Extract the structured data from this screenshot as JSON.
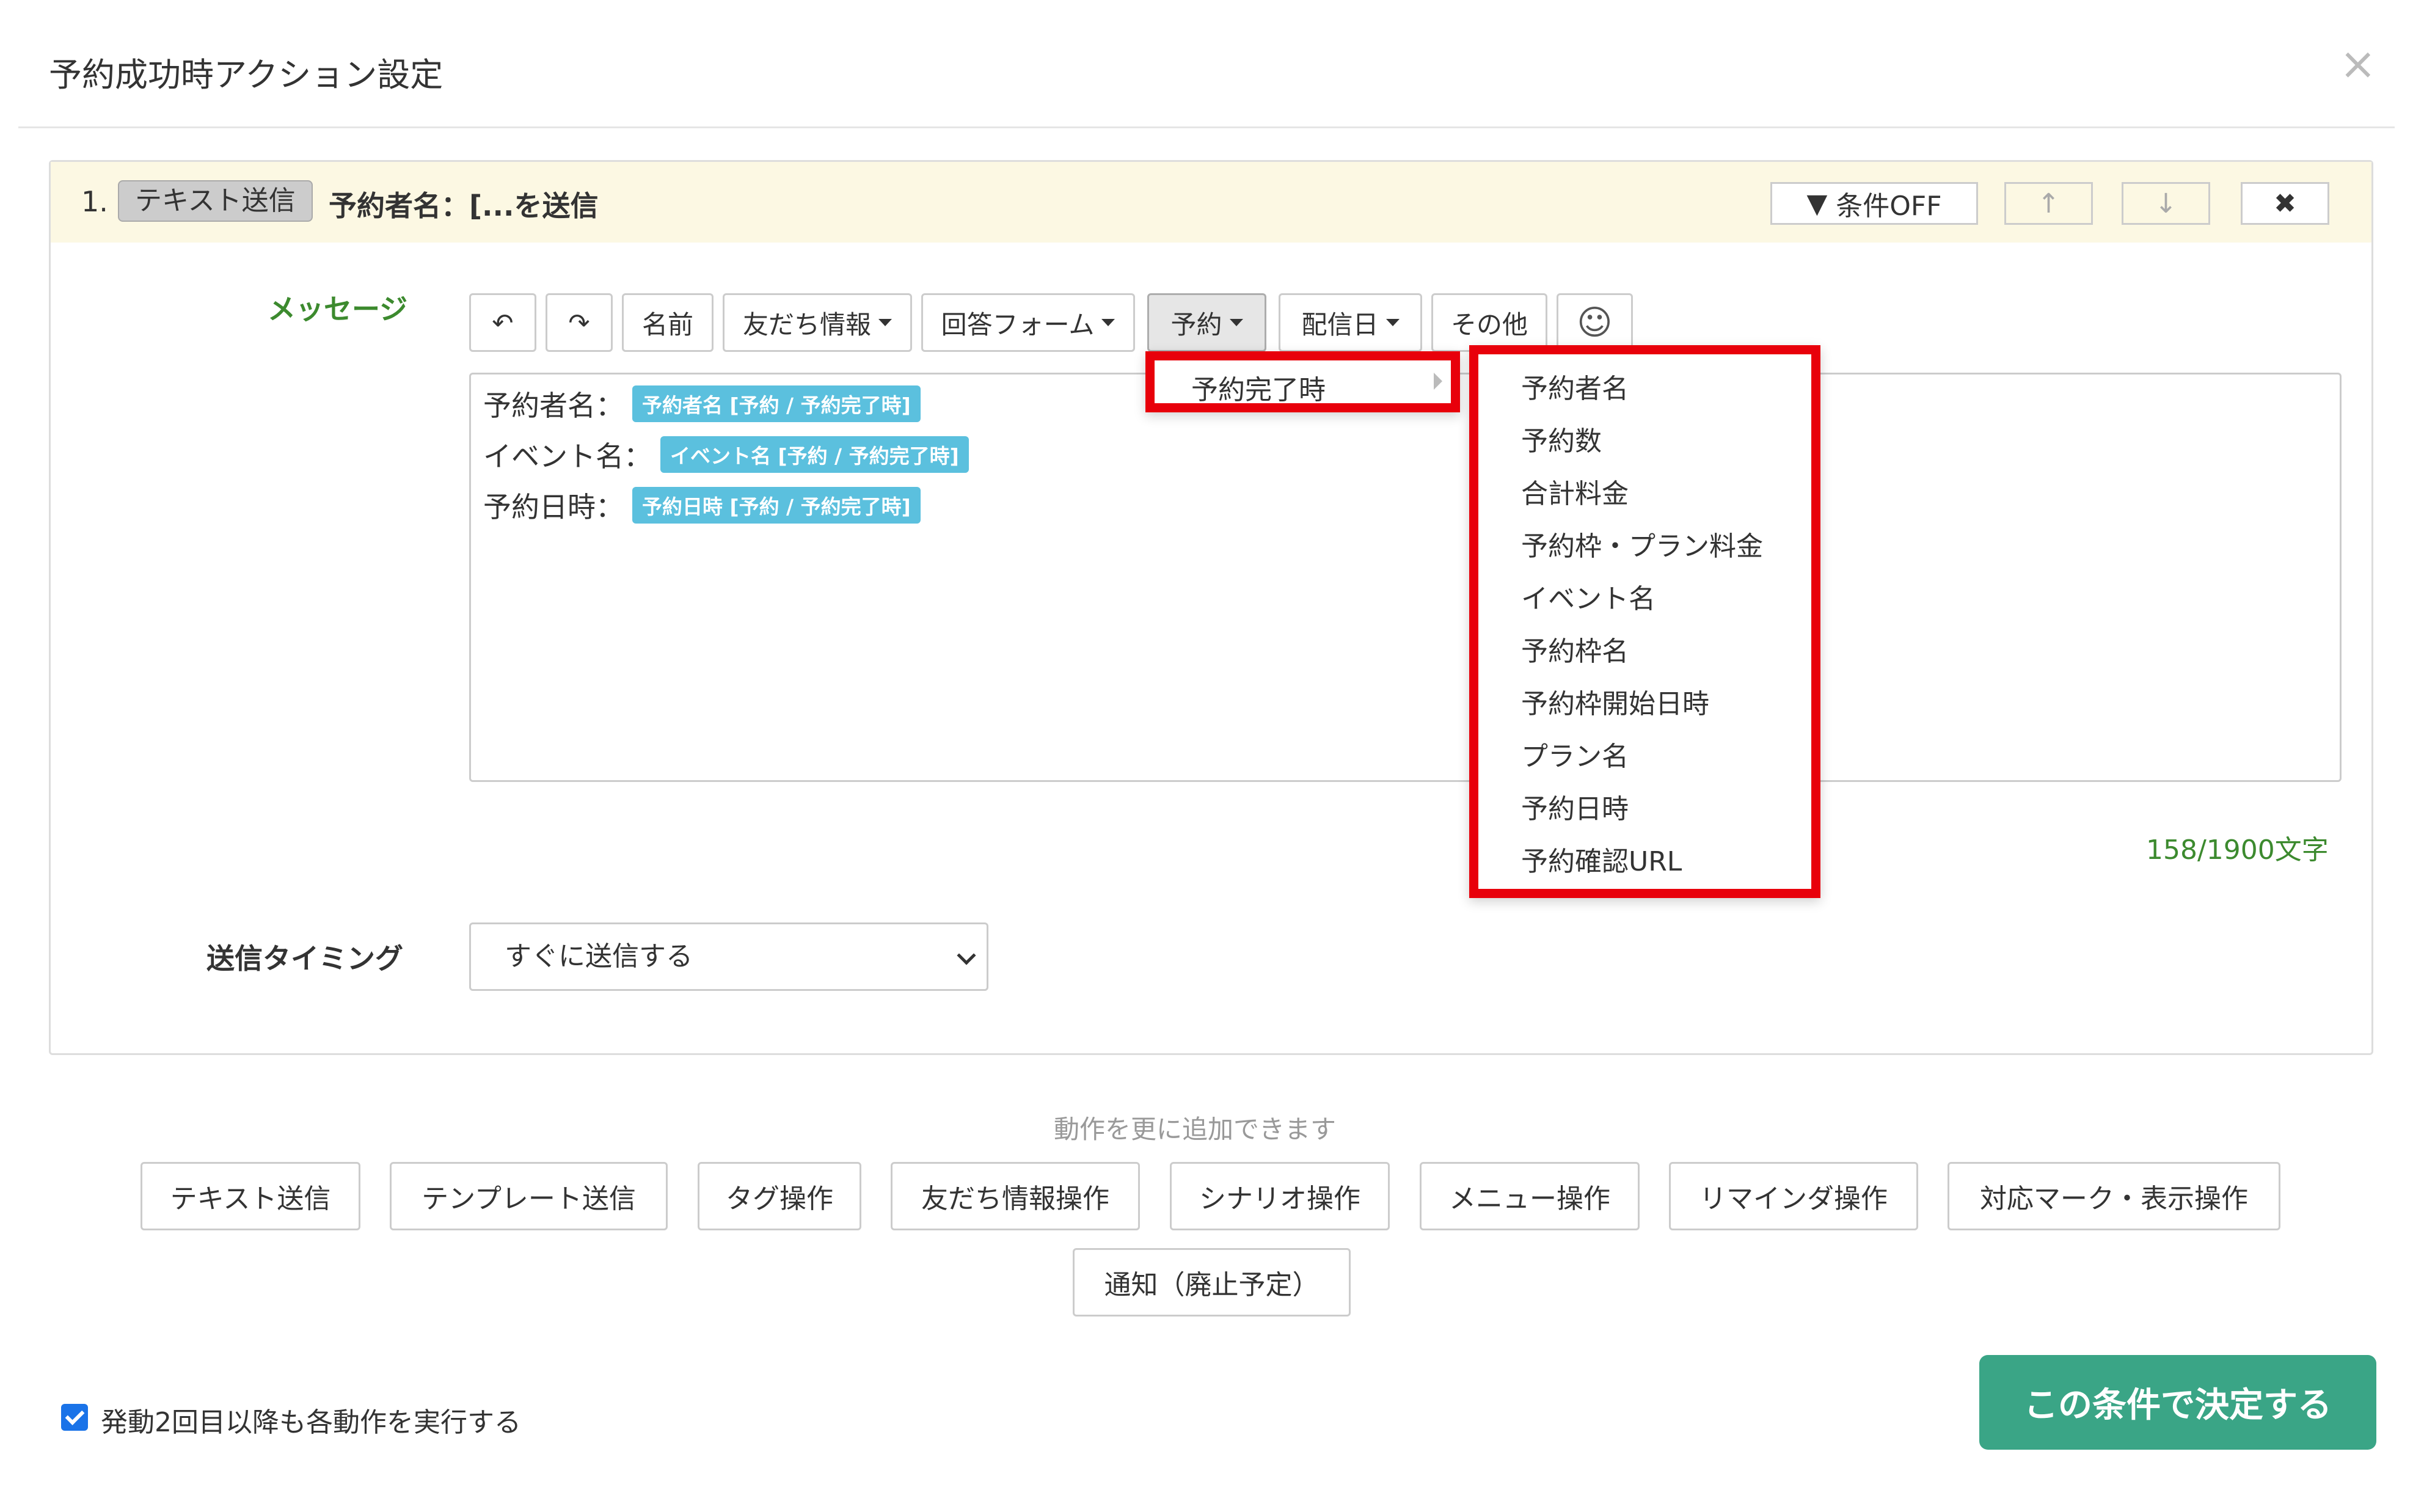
{
  "modal": {
    "title": "予約成功時アクション設定",
    "close_glyph": "×"
  },
  "action": {
    "number": "1.",
    "type_tag": "テキスト送信",
    "summary": "予約者名：[...を送信",
    "condition_label": "条件OFF",
    "filter_glyph": "▼",
    "up_glyph": "↑",
    "down_glyph": "↓",
    "delete_glyph": "✖"
  },
  "message": {
    "label": "メッセージ",
    "toolbar": {
      "undo_glyph": "↶",
      "redo_glyph": "↷",
      "name": "名前",
      "friend_info": "友だち情報",
      "answer_form": "回答フォーム",
      "reservation": "予約",
      "delivery_date": "配信日",
      "other": "その他",
      "emoji_glyph": "☺"
    },
    "lines": [
      {
        "label": "予約者名：",
        "chip": "予約者名 [予約 / 予約完了時]"
      },
      {
        "label": "イベント名：",
        "chip": "イベント名 [予約 / 予約完了時]"
      },
      {
        "label": "予約日時：",
        "chip": "予約日時 [予約 / 予約完了時]"
      }
    ],
    "counter": "158/1900文字"
  },
  "reservation_menu": {
    "submenu_label": "予約完了時",
    "items": [
      "予約者名",
      "予約数",
      "合計料金",
      "予約枠・プラン料金",
      "イベント名",
      "予約枠名",
      "予約枠開始日時",
      "プラン名",
      "予約日時",
      "予約確認URL"
    ]
  },
  "timing": {
    "label": "送信タイミング",
    "selected": "すぐに送信する"
  },
  "add_actions": {
    "hint": "動作を更に追加できます",
    "buttons": [
      "テキスト送信",
      "テンプレート送信",
      "タグ操作",
      "友だち情報操作",
      "シナリオ操作",
      "メニュー操作",
      "リマインダ操作",
      "対応マーク・表示操作",
      "通知（廃止予定）"
    ]
  },
  "footer": {
    "checkbox_label": "発動2回目以降も各動作を実行する",
    "checkbox_checked": true,
    "confirm_label": "この条件で決定する"
  },
  "colors": {
    "header_bg": "#fcf8e3",
    "label_green": "#3c8a2e",
    "chip_blue": "#5bc0de",
    "highlight_red": "#e8000b",
    "confirm_green": "#3aa586"
  }
}
